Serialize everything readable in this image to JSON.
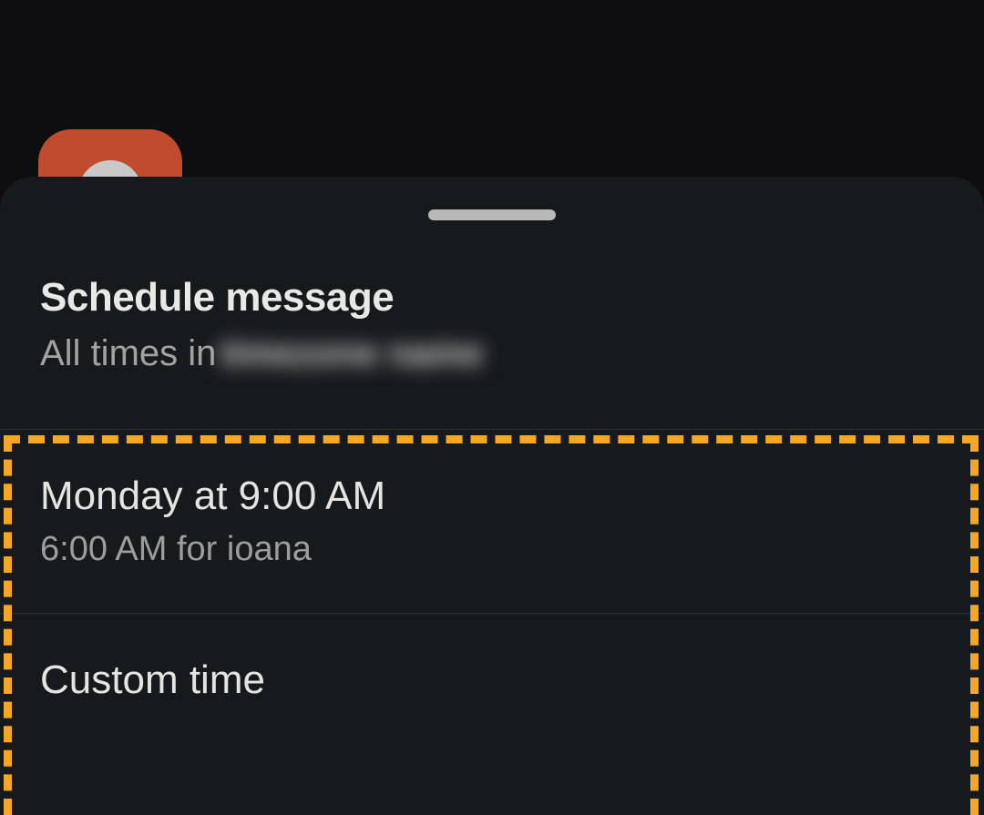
{
  "background": {
    "avatar_color": "#c14b2e"
  },
  "sheet": {
    "title": "Schedule message",
    "subtitle_prefix": "All times in",
    "subtitle_redacted": "timezone name",
    "options": [
      {
        "title": "Monday at 9:00 AM",
        "subtitle": "6:00 AM for ioana"
      },
      {
        "title": "Custom time",
        "subtitle": ""
      }
    ]
  },
  "annotation": {
    "highlight_color": "#f5a623"
  }
}
